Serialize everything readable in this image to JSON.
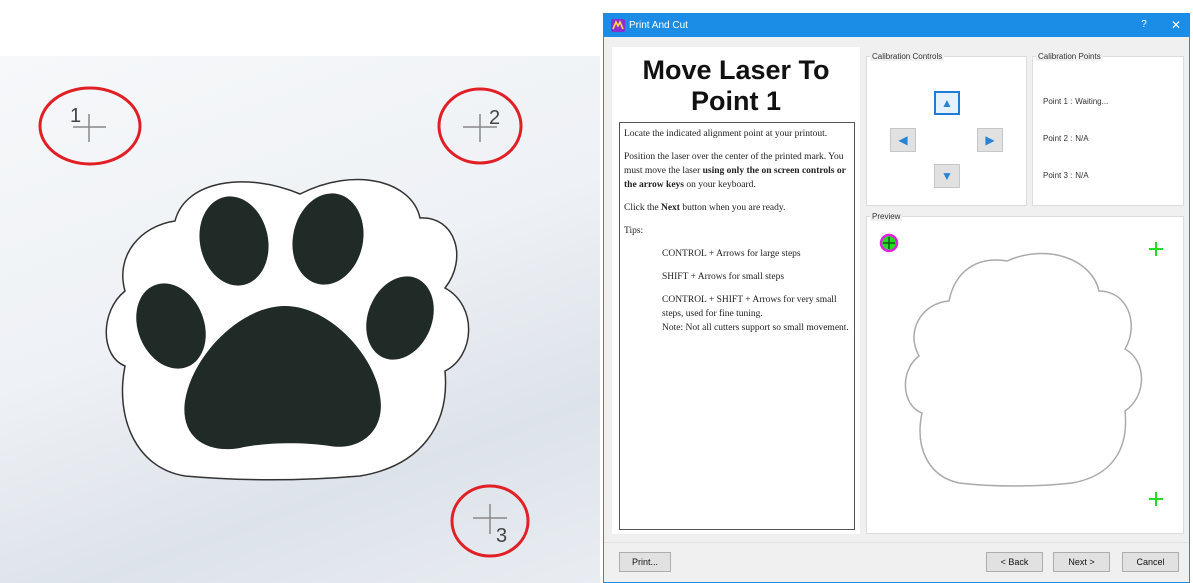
{
  "photo": {
    "markers": [
      {
        "number": "1"
      },
      {
        "number": "2"
      },
      {
        "number": "3"
      }
    ],
    "marker_ring_color": "#e02025",
    "paw_color": "#202a26"
  },
  "dialog": {
    "title": "Print And Cut",
    "help_label": "?",
    "close_label": "✕",
    "accent_color": "#1c8de6"
  },
  "instructions": {
    "heading_line1": "Move Laser To",
    "heading_line2": "Point 1",
    "para1": "Locate the indicated alignment point at your printout.",
    "para2_start": "Position the laser over the center of the printed mark. You must move the laser ",
    "para2_bold": "using only the on screen controls or the arrow keys",
    "para2_end": " on your keyboard.",
    "para3_start": "Click the ",
    "para3_bold": "Next",
    "para3_end": " button when you are ready.",
    "tips_label": "Tips:",
    "tip1": "CONTROL + Arrows for large steps",
    "tip2": "SHIFT + Arrows for small steps",
    "tip3": "CONTROL + SHIFT + Arrows for very small steps, used for fine tuning.",
    "tip4": "Note: Not all cutters support so small movement."
  },
  "calibration_controls": {
    "legend": "Calibration Controls",
    "up_icon": "▲",
    "left_icon": "◀",
    "right_icon": "▶",
    "down_icon": "▼"
  },
  "calibration_points": {
    "legend": "Calibration Points",
    "points": [
      {
        "label": "Point 1 :",
        "status": "Waiting..."
      },
      {
        "label": "Point 2 :",
        "status": "N/A"
      },
      {
        "label": "Point 3 :",
        "status": "N/A"
      }
    ]
  },
  "preview": {
    "legend": "Preview",
    "active_marker_color": "#e020e0",
    "marker_color": "#22dd22"
  },
  "buttons": {
    "print": "Print...",
    "back": "< Back",
    "next": "Next >",
    "cancel": "Cancel"
  }
}
